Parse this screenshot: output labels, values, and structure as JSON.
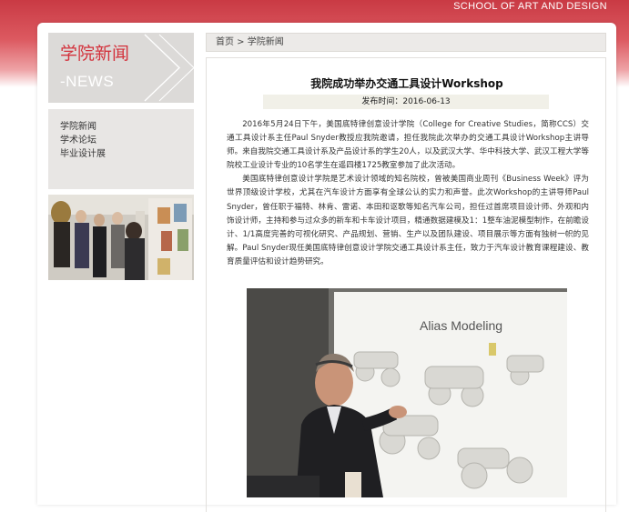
{
  "header": {
    "school_name": "SCHOOL OF ART AND DESIGN"
  },
  "sidebar": {
    "title_cn": "学院新闻",
    "title_en": "-NEWS",
    "items": [
      {
        "label": "学院新闻"
      },
      {
        "label": "学术论坛"
      },
      {
        "label": "毕业设计展"
      }
    ]
  },
  "breadcrumb": {
    "home": "首页",
    "separator": " > ",
    "current": "学院新闻"
  },
  "article": {
    "title": "我院成功举办交通工具设计Workshop",
    "publish_date": "发布时间：2016-06-13",
    "paragraphs": [
      "2016年5月24日下午，美国底特律创意设计学院（College for Creative Studies，简称CCS）交通工具设计系主任Paul Snyder教授应我院邀请，担任我院此次举办的交通工具设计Workshop主讲导师。来自我院交通工具设计系及产品设计系的学生20人，以及武汉大学、华中科技大学、武汉工程大学等院校工业设计专业的10名学生在遥四楼1725教室参加了此次活动。",
      "美国底特律创意设计学院是艺术设计领域的知名院校，曾被美国商业周刊《Business Week》评为世界顶级设计学校，尤其在汽车设计方面享有全球公认的实力和声誉。此次Workshop的主讲导师Paul Snyder，曾任职于福特、林肯、雷诺、本田和讴歌等知名汽车公司，担任过首席项目设计师、外观和内饰设计师，主持和参与过众多的新车和卡车设计项目，精通数据建模及1：1整车油泥模型制作，在前瞻设计、1/1高度完善的可视化研究、产品规划、营销、生产以及团队建设、项目展示等方面有独树一帜的见解。Paul Snyder现任美国底特律创意设计学院交通工具设计系主任，致力于汽车设计教育课程建设、教育质量评估和设计趋势研究。"
    ],
    "slide_heading": "Alias Modeling"
  }
}
